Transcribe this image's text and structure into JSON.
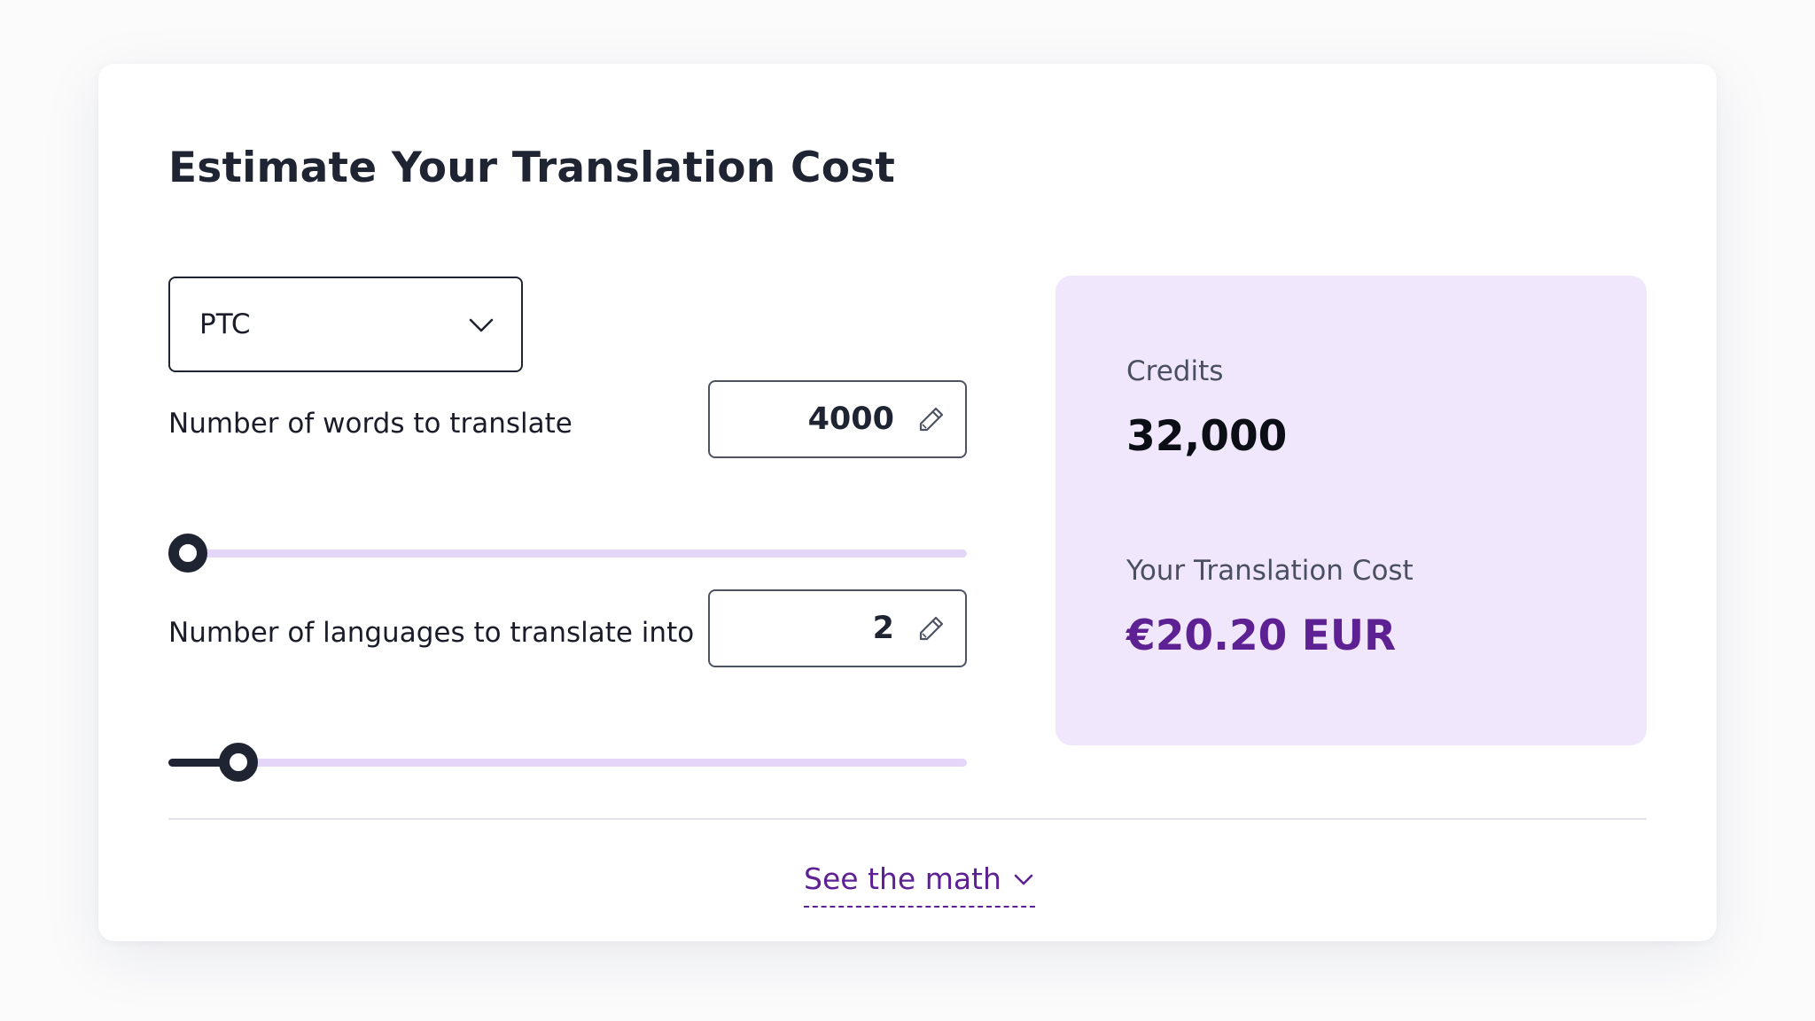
{
  "calculator": {
    "title": "Estimate Your Translation Cost",
    "product_select": {
      "selected": "PTC",
      "icon": "chevron-down-icon"
    },
    "words": {
      "label": "Number of words to translate",
      "value": "4000",
      "slider_fraction": 0.0
    },
    "languages": {
      "label": "Number of languages to translate into",
      "value": "2",
      "slider_fraction": 0.066
    },
    "edit_icon": "pencil-icon"
  },
  "result": {
    "credits_label": "Credits",
    "credits_value": "32,000",
    "cost_label": "Your Translation Cost",
    "cost_value": "€20.20 EUR"
  },
  "footer": {
    "see_math_label": "See the math",
    "icon": "chevron-down-icon"
  },
  "colors": {
    "accent": "#5e2193",
    "panel_bg": "#f1e7fd",
    "slider_track": "#e4d6f8",
    "dark": "#1f2433"
  }
}
